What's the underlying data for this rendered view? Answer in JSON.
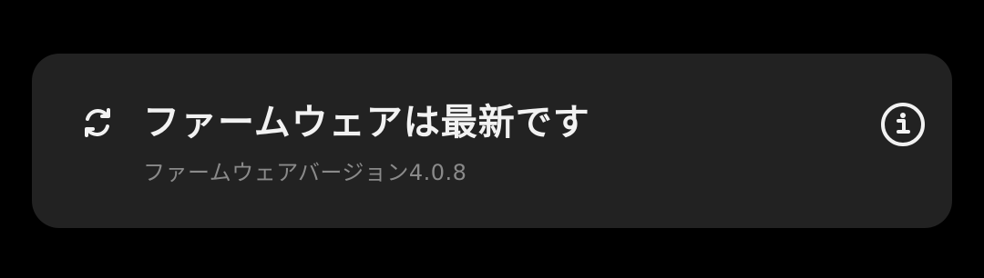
{
  "firmware_card": {
    "title": "ファームウェアは最新です",
    "subtitle": "ファームウェアバージョン4.0.8",
    "icon": "sync-icon",
    "info_icon": "info-icon"
  },
  "colors": {
    "background": "#000000",
    "card": "#222222",
    "title": "#f2f2f2",
    "subtitle": "#8a8a8a",
    "icon": "#f2f2f2"
  }
}
